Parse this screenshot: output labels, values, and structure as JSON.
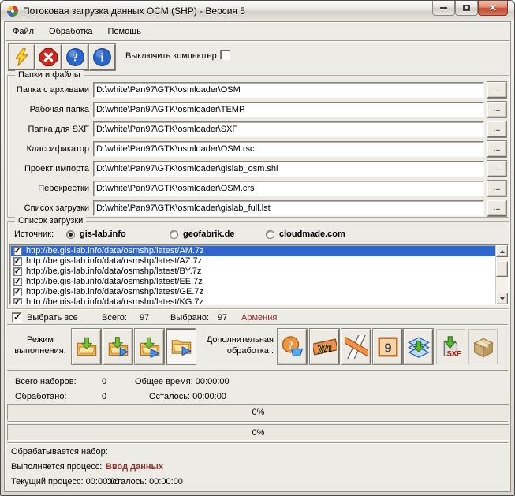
{
  "window": {
    "title": "Потоковая загрузка данных ОСМ (SHP) - Версия 5",
    "controls": [
      {
        "name": "minimize",
        "icon": "minimize-icon"
      },
      {
        "name": "maximize",
        "icon": "maximize-icon"
      },
      {
        "name": "close",
        "icon": "close-icon"
      }
    ]
  },
  "menu": {
    "items": [
      "Файл",
      "Обработка",
      "Помощь"
    ]
  },
  "toolbar": {
    "buttons": [
      {
        "name": "start",
        "icon": "lightning-icon"
      },
      {
        "name": "stop",
        "icon": "stop-icon"
      },
      {
        "name": "help",
        "icon": "help-icon"
      },
      {
        "name": "about",
        "icon": "info-icon"
      }
    ],
    "shutdown_label": "Выключить компьютер",
    "shutdown_checked": false
  },
  "folders": {
    "title": "Папки и файлы",
    "browse_label": "...",
    "rows": [
      {
        "label": "Папка с архивами",
        "value": "D:\\white\\Pan97\\GTK\\osmloader\\OSM"
      },
      {
        "label": "Рабочая папка",
        "value": "D:\\white\\Pan97\\GTK\\osmloader\\TEMP"
      },
      {
        "label": "Папка для SXF",
        "value": "D:\\white\\Pan97\\GTK\\osmloader\\SXF"
      },
      {
        "label": "Классификатор",
        "value": "D:\\white\\Pan97\\GTK\\osmloader\\OSM.rsc"
      },
      {
        "label": "Проект импорта",
        "value": "D:\\white\\Pan97\\GTK\\osmloader\\gislab_osm.shi"
      },
      {
        "label": "Перекрестки",
        "value": "D:\\white\\Pan97\\GTK\\osmloader\\OSM.crs"
      },
      {
        "label": "Список загрузки",
        "value": "D:\\white\\Pan97\\GTK\\osmloader\\gislab_full.lst"
      }
    ]
  },
  "downloads": {
    "title": "Список загрузки",
    "source_label": "Источник:",
    "sources": [
      {
        "label": "gis-lab.info",
        "selected": true
      },
      {
        "label": "geofabrik.de",
        "selected": false
      },
      {
        "label": "cloudmade.com",
        "selected": false
      }
    ],
    "urls": [
      {
        "text": "http://be.gis-lab.info/data/osmshp/latest/AM.7z",
        "checked": true,
        "selected": true
      },
      {
        "text": "http://be.gis-lab.info/data/osmshp/latest/AZ.7z",
        "checked": true
      },
      {
        "text": "http://be.gis-lab.info/data/osmshp/latest/BY.7z",
        "checked": true
      },
      {
        "text": "http://be.gis-lab.info/data/osmshp/latest/EE.7z",
        "checked": true
      },
      {
        "text": "http://be.gis-lab.info/data/osmshp/latest/GE.7z",
        "checked": true
      },
      {
        "text": "http://be.gis-lab.info/data/osmshp/latest/KG.7z",
        "checked": true
      }
    ]
  },
  "selection": {
    "select_all_label": "Выбрать все",
    "select_all_checked": true,
    "total_label": "Всего:",
    "total_value": "97",
    "chosen_label": "Выбрано:",
    "chosen_value": "97",
    "region": "Армения"
  },
  "modes": {
    "label_line1": "Режим",
    "label_line2": "выполнения:",
    "buttons": [
      {
        "icon": "folder-download-icon",
        "pressed": false
      },
      {
        "icon": "folder-download-run-icon",
        "pressed": false
      },
      {
        "icon": "folder-download-run-alt-icon",
        "pressed": false
      },
      {
        "icon": "folder-run-icon",
        "pressed": true
      }
    ],
    "extra_label_line1": "Дополнительная",
    "extra_label_line2": "обработка :",
    "extra_buttons": [
      {
        "icon": "unknown-object-icon"
      },
      {
        "icon": "street-names-icon"
      },
      {
        "icon": "crossroads-icon"
      },
      {
        "icon": "house-number-icon"
      },
      {
        "icon": "layers-merge-icon"
      },
      {
        "icon": "sxf-export-icon",
        "flat": true
      },
      {
        "icon": "package-icon",
        "flat": true
      }
    ]
  },
  "stats": {
    "total_sets_label": "Всего наборов:",
    "total_sets_value": "0",
    "total_time_label": "Общее время:",
    "total_time_value": "00:00:00",
    "processed_label": "Обработано:",
    "processed_value": "0",
    "remaining_label": "Осталось:",
    "remaining_value": "00:00:00"
  },
  "progress": {
    "bar1": "0%",
    "bar2": "0%"
  },
  "status": {
    "set_label": "Обрабатывается набор:",
    "process_label": "Выполняется процесс:",
    "process_value": "Ввод данных",
    "current_label": "Текущий процесс:",
    "current_value": "00:00:00",
    "left_label": "Осталось:",
    "left_value": "00:00:00"
  },
  "colors": {
    "selection_blue": "#2f67d1",
    "maroon_text": "#94302a",
    "window_bg": "#ecebe5"
  }
}
